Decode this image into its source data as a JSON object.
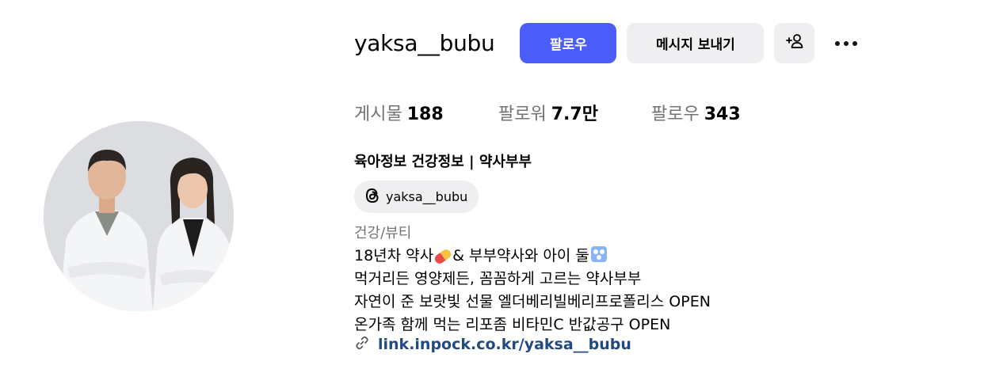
{
  "profile": {
    "username": "yaksa__bubu",
    "follow_label": "팔로우",
    "message_label": "메시지 보내기",
    "add_user_icon": "add-user-icon",
    "more_icon": "more-options-icon"
  },
  "stats": {
    "posts_label": "게시물",
    "posts_value": "188",
    "followers_label": "팔로워",
    "followers_value": "7.7만",
    "following_label": "팔로우",
    "following_value": "343"
  },
  "bio": {
    "name": "육아정보 건강정보 | 약사부부",
    "threads_handle": "yaksa__bubu",
    "category": "건강/뷰티",
    "line1_a": "18년차 약사",
    "line1_b": "& 부부약사와 아이 둘",
    "line2": "먹거리든 영양제든, 꼼꼼하게 고르는 약사부부",
    "line3": "자연이 준 보랏빛 선물 엘더베리빌베리프로폴리스 OPEN",
    "line4": "온가족 함께 먹는 리포좀 비타민C 반값공구 OPEN",
    "link": "link.inpock.co.kr/yaksa__bubu"
  },
  "colors": {
    "accent": "#4a5df9",
    "secondary_button": "#efeff1",
    "muted_text": "#737373",
    "link": "#224a7f"
  }
}
